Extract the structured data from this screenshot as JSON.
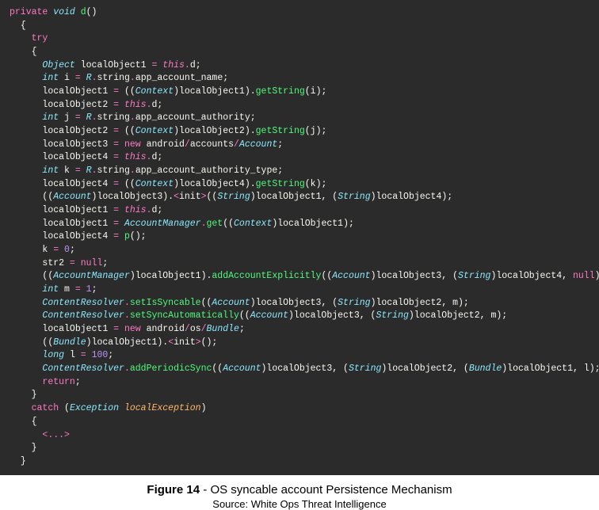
{
  "code": {
    "l1_private": "private",
    "l1_void": "void",
    "l1_name": "d",
    "brace_open": "{",
    "brace_close": "}",
    "try": "try",
    "obj_type": "Object",
    "localObject1": "localObject1",
    "localObject2": "localObject2",
    "localObject3": "localObject3",
    "localObject4": "localObject4",
    "this": "this",
    "d_field": "d",
    "int": "int",
    "i": "i",
    "j": "j",
    "k": "k",
    "m": "m",
    "l": "l",
    "R": "R",
    "string": "string",
    "app_account_name": "app_account_name",
    "app_account_authority": "app_account_authority",
    "app_account_authority_type": "app_account_authority_type",
    "Context": "Context",
    "getString": "getString",
    "new": "new",
    "android": "android",
    "accounts": "accounts",
    "Account": "Account",
    "String": "String",
    "init": "init",
    "AccountManager": "AccountManager",
    "get": "get",
    "p": "p",
    "zero": "0",
    "str2": "str2",
    "null": "null",
    "addAccountExplicitly": "addAccountExplicitly",
    "one": "1",
    "ContentResolver": "ContentResolver",
    "setIsSyncable": "setIsSyncable",
    "setSyncAutomatically": "setSyncAutomatically",
    "os": "os",
    "Bundle": "Bundle",
    "long": "long",
    "hundred": "100",
    "addPeriodicSync": "addPeriodicSync",
    "return": "return",
    "catch": "catch",
    "Exception": "Exception",
    "localException": "localException",
    "ellipsis": "<...>",
    "eq": " = ",
    "semi": ";",
    "lparen": "(",
    "rparen": ")",
    "comma": ", ",
    "lt": "<",
    "gt": ">"
  },
  "caption": {
    "fig": "Figure 14",
    "sep": " - ",
    "text": "OS syncable account Persistence Mechanism"
  },
  "source": "Source: White Ops Threat Intelligence"
}
